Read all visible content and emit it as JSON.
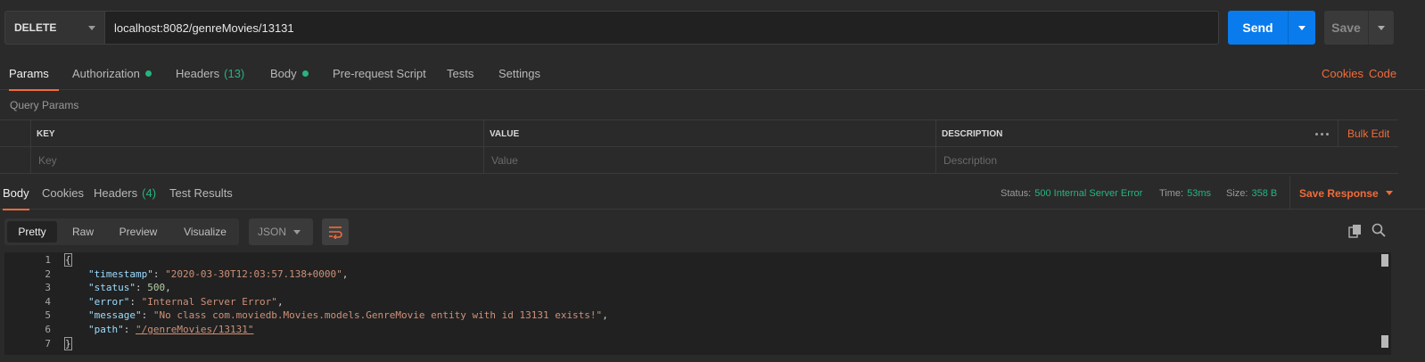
{
  "request": {
    "method": "DELETE",
    "url": "localhost:8082/genreMovies/13131",
    "send_label": "Send",
    "save_label": "Save"
  },
  "request_tabs": {
    "params": "Params",
    "authorization": "Authorization",
    "headers": "Headers",
    "headers_count": "(13)",
    "body": "Body",
    "prerequest": "Pre-request Script",
    "tests": "Tests",
    "settings": "Settings",
    "cookies": "Cookies",
    "code": "Code"
  },
  "query_params": {
    "title": "Query Params",
    "columns": {
      "key": "KEY",
      "value": "VALUE",
      "description": "DESCRIPTION"
    },
    "placeholders": {
      "key": "Key",
      "value": "Value",
      "description": "Description"
    },
    "bulk_edit": "Bulk Edit"
  },
  "response_tabs": {
    "body": "Body",
    "cookies": "Cookies",
    "headers": "Headers",
    "headers_count": "(4)",
    "test_results": "Test Results"
  },
  "response_meta": {
    "status_label": "Status:",
    "status_value": "500 Internal Server Error",
    "time_label": "Time:",
    "time_value": "53ms",
    "size_label": "Size:",
    "size_value": "358 B",
    "save_response": "Save Response"
  },
  "view_modes": {
    "pretty": "Pretty",
    "raw": "Raw",
    "preview": "Preview",
    "visualize": "Visualize",
    "format": "JSON"
  },
  "response_body": {
    "line_numbers": [
      "1",
      "2",
      "3",
      "4",
      "5",
      "6",
      "7"
    ],
    "open_brace": "{",
    "close_brace": "}",
    "fields": [
      {
        "key": "\"timestamp\"",
        "value": "\"2020-03-30T12:03:57.138+0000\""
      },
      {
        "key": "\"status\"",
        "value": "500"
      },
      {
        "key": "\"error\"",
        "value": "\"Internal Server Error\""
      },
      {
        "key": "\"message\"",
        "value": "\"No class com.moviedb.Movies.models.GenreMovie entity with id 13131 exists!\""
      },
      {
        "key": "\"path\"",
        "value": "\"/genreMovies/13131\""
      }
    ]
  },
  "colors": {
    "accent": "#f26b3a",
    "primary": "#097bed",
    "success": "#26b47f",
    "json_key": "#9cdcfe",
    "json_string": "#ce9178",
    "json_number": "#b5cea8"
  }
}
